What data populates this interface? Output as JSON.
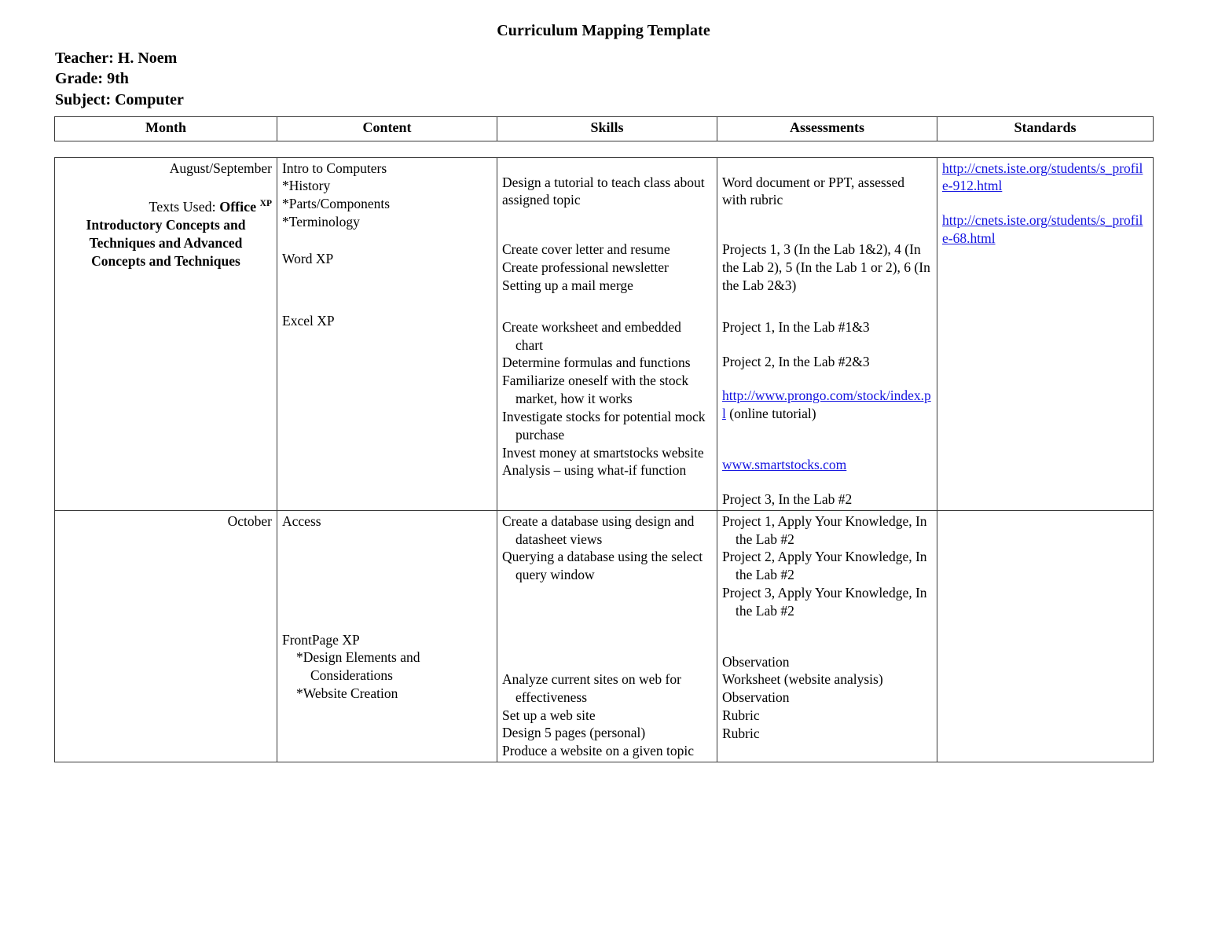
{
  "document": {
    "title": "Curriculum Mapping Template",
    "meta": {
      "teacher": "Teacher: H. Noem",
      "grade": "Grade: 9th",
      "subject": "Subject: Computer"
    }
  },
  "table": {
    "headers": {
      "month": "Month",
      "content": "Content",
      "skills": "Skills",
      "assessments": "Assessments",
      "standards": "Standards"
    },
    "rows": [
      {
        "month": {
          "name": "August/September",
          "texts_label": "Texts Used: ",
          "texts_bold": "Office ",
          "texts_sup": "XP",
          "texts_title_lines": [
            "Introductory Concepts and",
            "Techniques and Advanced",
            "Concepts and Techniques"
          ]
        },
        "content": {
          "group1": [
            "Intro to Computers",
            "*History",
            "*Parts/Components",
            "*Terminology"
          ],
          "group2": [
            "Word XP"
          ],
          "group3": [
            "Excel XP"
          ]
        },
        "skills": {
          "group1": [
            "Design a tutorial to teach class about assigned topic"
          ],
          "group2": [
            "Create cover letter and resume",
            "Create professional newsletter",
            "Setting up a mail merge"
          ],
          "group3": [
            "Create worksheet and embedded chart",
            "Determine formulas and functions",
            "Familiarize oneself with the stock market, how it works",
            "Investigate stocks for potential mock purchase",
            "Invest money at smartstocks website",
            "Analysis – using what-if function"
          ]
        },
        "assessments": {
          "group1": [
            "Word document or PPT, assessed with rubric"
          ],
          "group2": [
            "Projects 1, 3 (In the Lab 1&2), 4 (In the Lab 2), 5 (In the Lab 1 or 2), 6 (In the Lab 2&3)"
          ],
          "group3_a": "Project 1, In the Lab #1&3",
          "group3_b": "Project 2, In the Lab #2&3",
          "link1_text": "http://www.prongo.com/stock/index.pl",
          "link1_suffix": " (online tutorial)",
          "link2_text": "www.smartstocks.com",
          "group3_c": "Project 3, In the Lab #2"
        },
        "standards": {
          "link1": "http://cnets.iste.org/students/s_profile-912.html",
          "link2": "http://cnets.iste.org/students/s_profile-68.html"
        }
      },
      {
        "month": {
          "name": "October"
        },
        "content": {
          "group1": [
            "Access"
          ],
          "group2": [
            "FrontPage XP",
            "*Design Elements and",
            "Considerations",
            "*Website Creation"
          ]
        },
        "skills": {
          "group1": [
            "Create a database using design and datasheet views",
            "Querying a database using the select query window"
          ],
          "group2": [
            "Analyze current sites on web for effectiveness",
            "Set up a web site",
            "Design 5 pages (personal)",
            "Produce a website on a given topic"
          ]
        },
        "assessments": {
          "group1": [
            "Project 1, Apply Your Knowledge, In the Lab #2",
            "Project 2, Apply Your Knowledge, In the Lab #2",
            "Project 3, Apply Your Knowledge, In the Lab #2"
          ],
          "group2": [
            "Observation",
            "Worksheet (website analysis)",
            "Observation",
            "Rubric",
            "Rubric"
          ]
        },
        "standards": {}
      }
    ]
  },
  "colors": {
    "link": "#1414e0",
    "border": "#3a3a3a",
    "text": "#000000"
  }
}
